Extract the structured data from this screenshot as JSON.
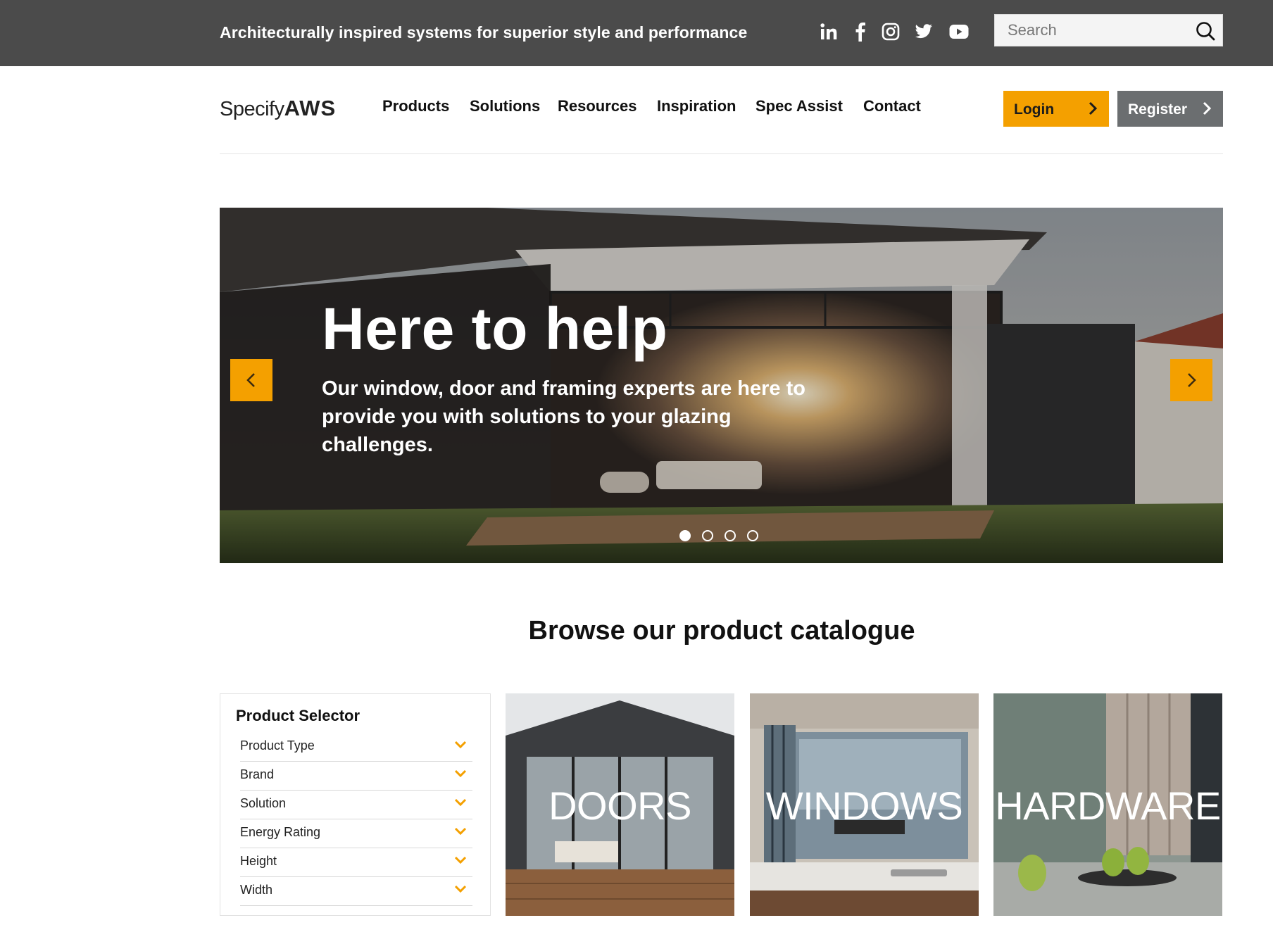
{
  "topbar": {
    "tagline": "Architecturally inspired systems for superior style and performance",
    "social": [
      "linkedin-icon",
      "facebook-icon",
      "instagram-icon",
      "twitter-icon",
      "youtube-icon"
    ],
    "search": {
      "placeholder": "Search",
      "value": ""
    }
  },
  "header": {
    "logo": {
      "part1": "Specify",
      "part2": "AWS"
    },
    "nav": [
      "Products",
      "Solutions",
      "Resources",
      "Inspiration",
      "Spec Assist",
      "Contact"
    ],
    "login_label": "Login",
    "register_label": "Register"
  },
  "hero": {
    "title": "Here to help",
    "subtitle": "Our window, door and framing experts are here to provide you with solutions to your glazing challenges.",
    "slides_count": 4,
    "active_slide": 1
  },
  "catalogue": {
    "title": "Browse our product catalogue",
    "selector": {
      "title": "Product Selector",
      "filters": [
        "Product Type",
        "Brand",
        "Solution",
        "Energy Rating",
        "Height",
        "Width"
      ]
    },
    "tiles": [
      "DOORS",
      "WINDOWS",
      "HARDWARE"
    ]
  },
  "colors": {
    "accent": "#f4a000",
    "topbar_bg": "#4b4b4b",
    "register_bg": "#6b6e70"
  }
}
